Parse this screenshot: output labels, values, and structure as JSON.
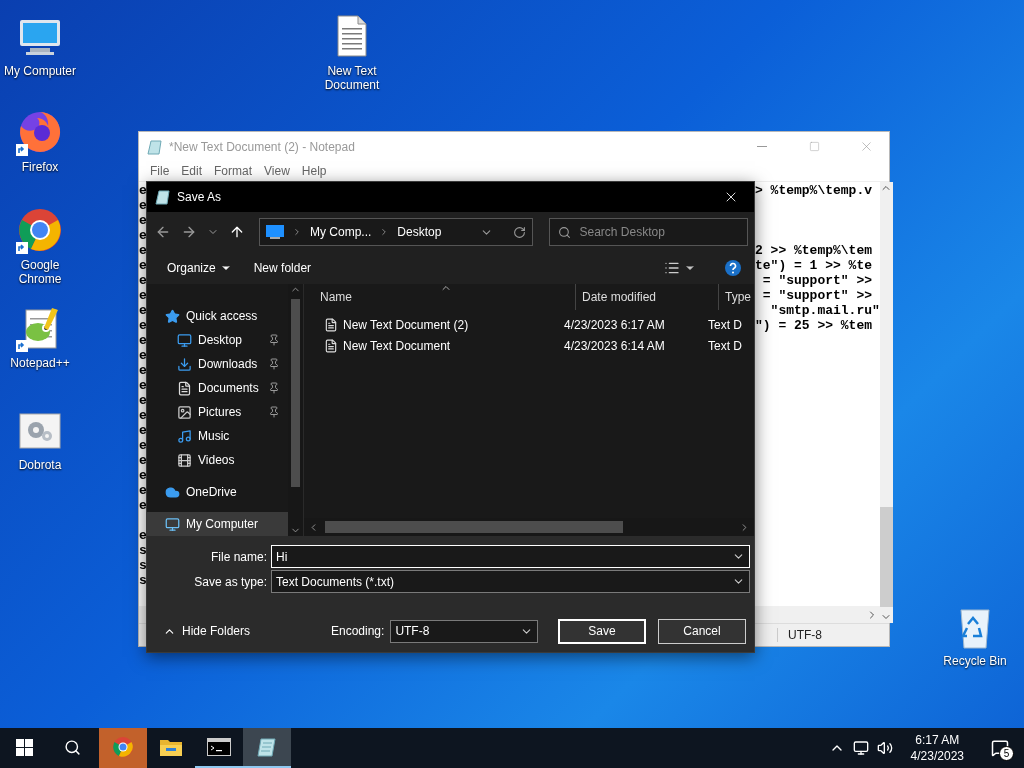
{
  "desktop_icons": [
    {
      "label": "My Computer",
      "kind": "computer",
      "shortcut": false
    },
    {
      "label": "New Text Document",
      "kind": "textfile",
      "shortcut": false
    },
    {
      "label": "Firefox",
      "kind": "firefox",
      "shortcut": true
    },
    {
      "label": "Google Chrome",
      "kind": "chrome",
      "shortcut": true
    },
    {
      "label": "Notepad++",
      "kind": "notepadpp",
      "shortcut": true
    },
    {
      "label": "Dobrota",
      "kind": "settingsfile",
      "shortcut": false
    },
    {
      "label": "Recycle Bin",
      "kind": "recycle",
      "shortcut": false
    }
  ],
  "notepad": {
    "title": "*New Text Document (2) - Notepad",
    "menu": [
      "File",
      "Edit",
      "Format",
      "View",
      "Help"
    ],
    "lines": [
      {
        "kind": "text",
        "left": "e",
        "right": "> %temp%\\temp.v"
      },
      {
        "kind": "text",
        "left": "e"
      },
      {
        "kind": "text",
        "left": "e"
      },
      {
        "kind": "text",
        "left": "e"
      },
      {
        "kind": "text",
        "left": "e",
        "right": "2 >> %temp%\\tem"
      },
      {
        "kind": "text",
        "left": "e",
        "right": "te\") = 1 >> %te"
      },
      {
        "kind": "text",
        "left": "e",
        "right": " = \"support\" >>"
      },
      {
        "kind": "text",
        "left": "e",
        "right": " = \"support\" >>"
      },
      {
        "kind": "text",
        "left": "e",
        "right": "  \"smtp.mail.ru\""
      },
      {
        "kind": "text",
        "left": "e",
        "right": "\") = 25 >> %tem"
      },
      {
        "kind": "text",
        "left": "e"
      },
      {
        "kind": "text",
        "left": "e"
      },
      {
        "kind": "text",
        "left": "e"
      },
      {
        "kind": "text",
        "left": "e"
      },
      {
        "kind": "text",
        "left": "e"
      },
      {
        "kind": "text",
        "left": "e"
      },
      {
        "kind": "text",
        "left": "e"
      },
      {
        "kind": "text",
        "left": "e"
      },
      {
        "kind": "text",
        "left": "e"
      },
      {
        "kind": "text",
        "left": "e"
      },
      {
        "kind": "text",
        "left": "e"
      },
      {
        "kind": "text",
        "left": "e"
      },
      {
        "kind": "blank"
      },
      {
        "kind": "text",
        "left": "e"
      },
      {
        "kind": "text",
        "left": "s"
      },
      {
        "kind": "text",
        "left": "s"
      },
      {
        "kind": "text",
        "left": "s"
      }
    ],
    "status": "UTF-8"
  },
  "save_dialog": {
    "title": "Save As",
    "breadcrumb": [
      "My Comp...",
      "Desktop"
    ],
    "search": {
      "placeholder": "Search Desktop"
    },
    "toolbar": [
      "Organize",
      "New folder"
    ],
    "nav": [
      {
        "label": "Quick access",
        "kind": "star",
        "pinned": false,
        "selected": false,
        "children": [
          {
            "label": "Desktop",
            "kind": "desktop",
            "pinned": true,
            "selected": false
          },
          {
            "label": "Downloads",
            "kind": "download",
            "pinned": true,
            "selected": false
          },
          {
            "label": "Documents",
            "kind": "document",
            "pinned": true,
            "selected": false
          },
          {
            "label": "Pictures",
            "kind": "picture",
            "pinned": true,
            "selected": false
          },
          {
            "label": "Music",
            "kind": "music",
            "pinned": false,
            "selected": false
          },
          {
            "label": "Videos",
            "kind": "video",
            "pinned": false,
            "selected": false
          }
        ]
      },
      {
        "label": "OneDrive",
        "kind": "cloud",
        "pinned": false,
        "selected": false
      },
      {
        "label": "My Computer",
        "kind": "computer",
        "pinned": false,
        "selected": true
      }
    ],
    "columns": [
      "Name",
      "Date modified",
      "Type"
    ],
    "files": [
      {
        "name": "New Text Document (2)",
        "date": "4/23/2023 6:17 AM",
        "type": "Text D"
      },
      {
        "name": "New Text Document",
        "date": "4/23/2023 6:14 AM",
        "type": "Text D"
      }
    ],
    "file_name": {
      "label": "File name:",
      "value": "Hi"
    },
    "save_type": {
      "label": "Save as type:",
      "value": "Text Documents (*.txt)"
    },
    "hide_folders": "Hide Folders",
    "encoding": {
      "label": "Encoding:",
      "value": "UTF-8"
    },
    "buttons": [
      {
        "label": "Save",
        "default": true
      },
      {
        "label": "Cancel",
        "default": false
      }
    ]
  },
  "taskbar": {
    "apps": [
      {
        "kind": "chrome",
        "flashing": true,
        "running": false,
        "active": false
      },
      {
        "kind": "explorer",
        "flashing": false,
        "running": false,
        "active": false
      },
      {
        "kind": "cmd",
        "flashing": false,
        "running": true,
        "active": false
      },
      {
        "kind": "notepad",
        "flashing": false,
        "running": true,
        "active": true
      }
    ],
    "clock": {
      "time": "6:17 AM",
      "date": "4/23/2023"
    },
    "notifications": "5"
  }
}
